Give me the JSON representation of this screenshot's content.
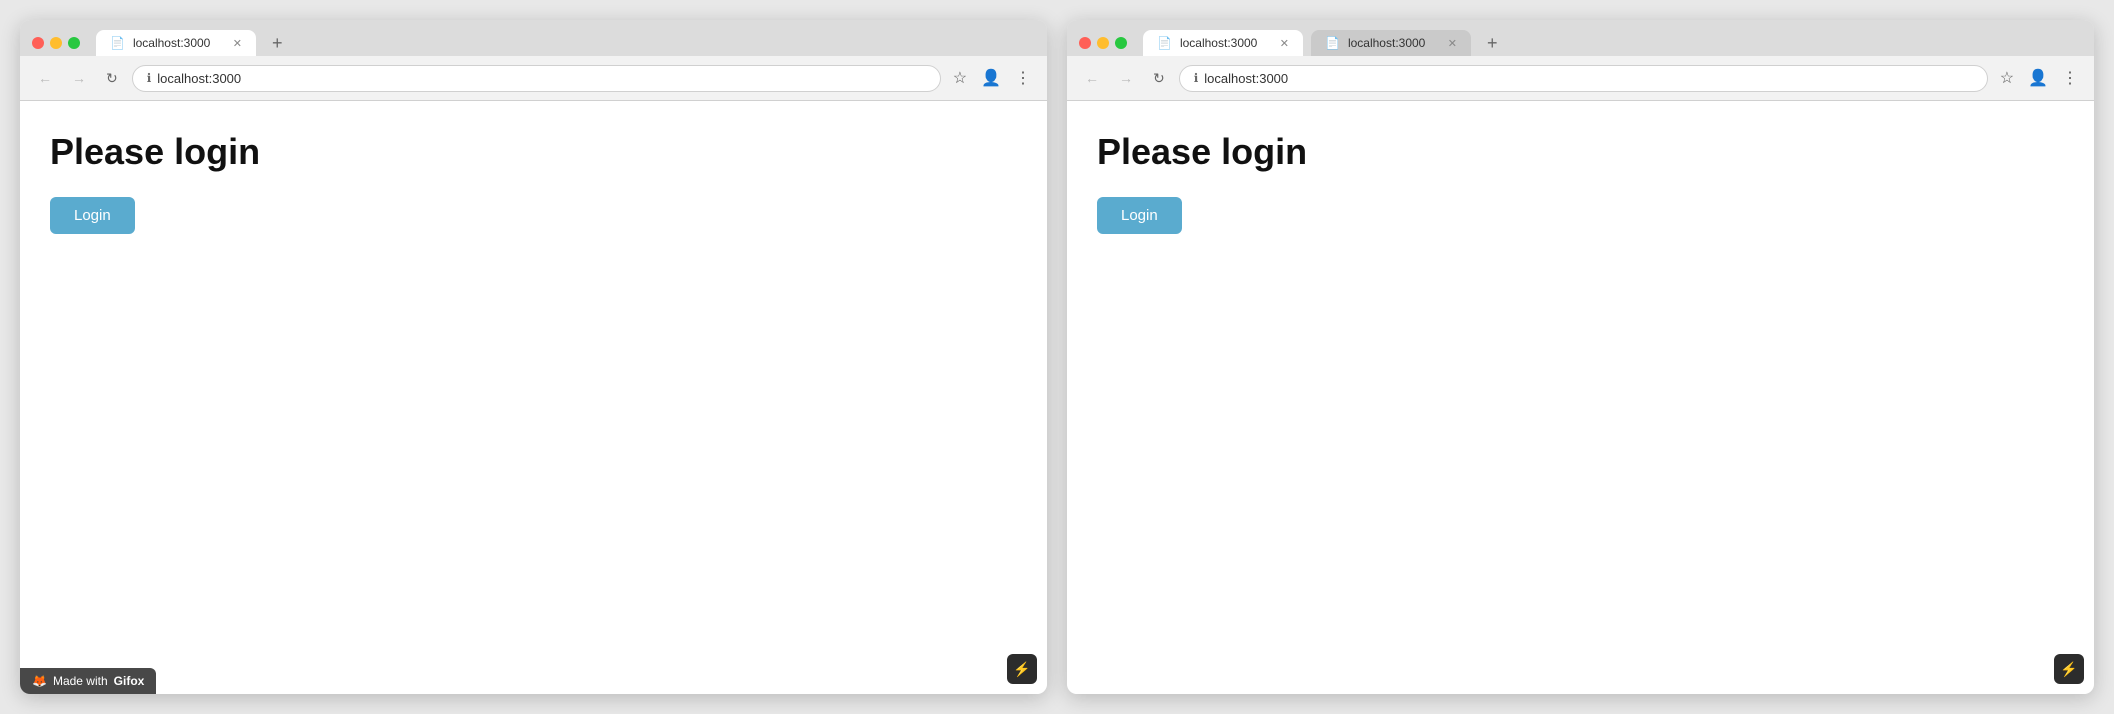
{
  "browser1": {
    "tab": {
      "label": "localhost:3000",
      "url": "localhost:3000"
    },
    "page": {
      "title": "Please login",
      "login_button": "Login"
    },
    "gifox": {
      "label": "Made with",
      "brand": "Gifox"
    }
  },
  "browser2": {
    "tab1": {
      "label": "localhost:3000",
      "url": "localhost:3000"
    },
    "tab2": {
      "label": "localhost:3000",
      "url": "localhost:3000"
    },
    "page": {
      "title": "Please login",
      "login_button": "Login"
    }
  },
  "nav": {
    "back": "←",
    "forward": "→",
    "reload": "↻",
    "star": "☆",
    "more": "⋮",
    "new_tab": "+"
  },
  "colors": {
    "login_btn": "#5aabcf",
    "traffic_red": "#ff5f57",
    "traffic_yellow": "#ffbd2e",
    "traffic_green": "#28c840"
  }
}
